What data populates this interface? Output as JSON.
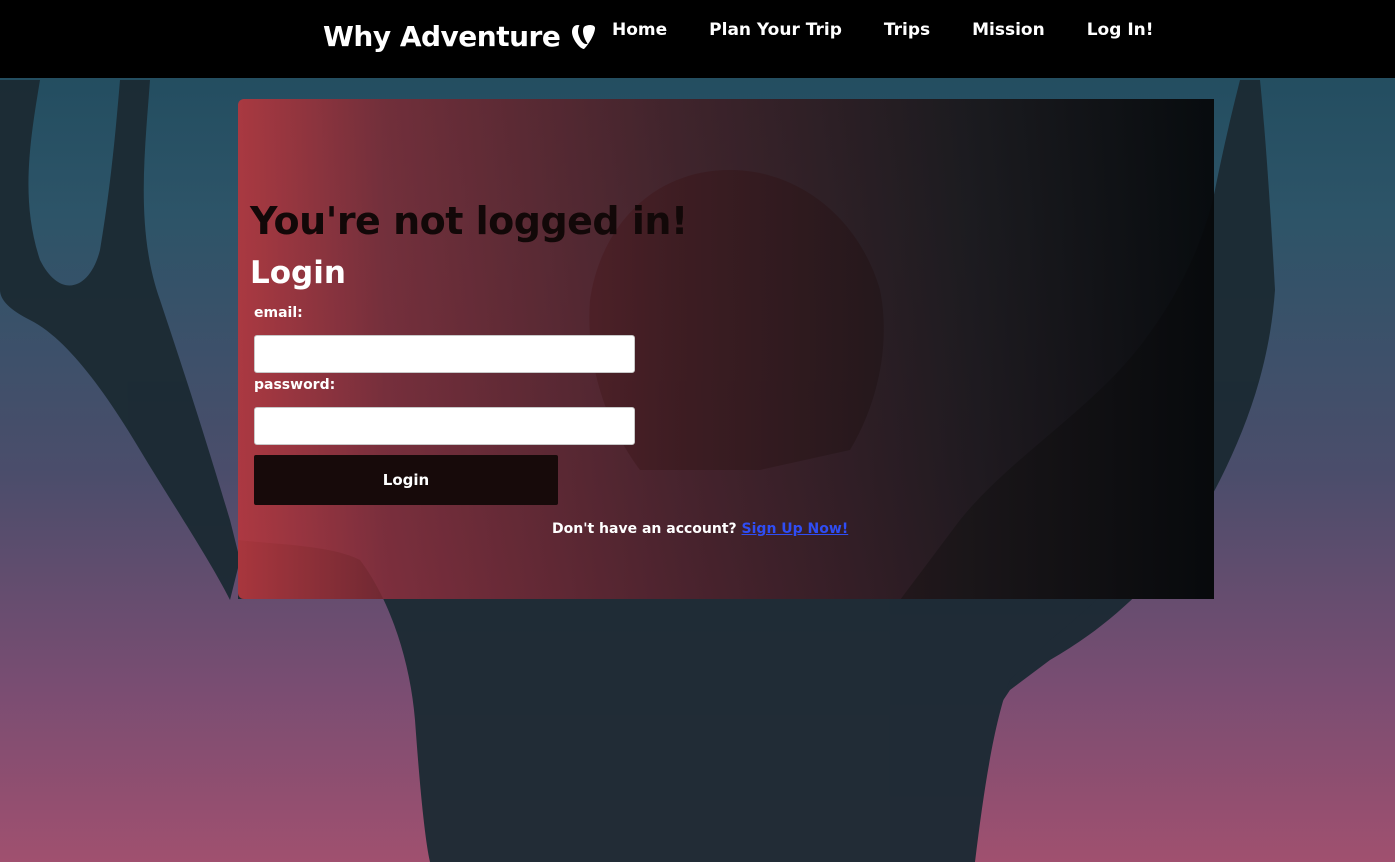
{
  "navbar": {
    "brand": "Why Adventure",
    "brand_icon": "typo3-logo-icon",
    "links": [
      {
        "label": "Home"
      },
      {
        "label": "Plan Your Trip"
      },
      {
        "label": "Trips"
      },
      {
        "label": "Mission"
      },
      {
        "label": "Log In!"
      }
    ]
  },
  "main": {
    "status_heading": "You're not logged in!",
    "form_title": "Login",
    "email_label": "email:",
    "email_value": "",
    "password_label": "password:",
    "password_value": "",
    "submit_label": "Login",
    "signup_prompt": "Don't have an account?",
    "signup_link": "Sign Up Now!"
  },
  "colors": {
    "navbar_bg": "#000000",
    "card_gradient_start": "#b4373e",
    "card_gradient_end": "#06080a",
    "button_bg": "#170a0a",
    "link": "#2f4df5",
    "heading_dark": "#120808"
  }
}
